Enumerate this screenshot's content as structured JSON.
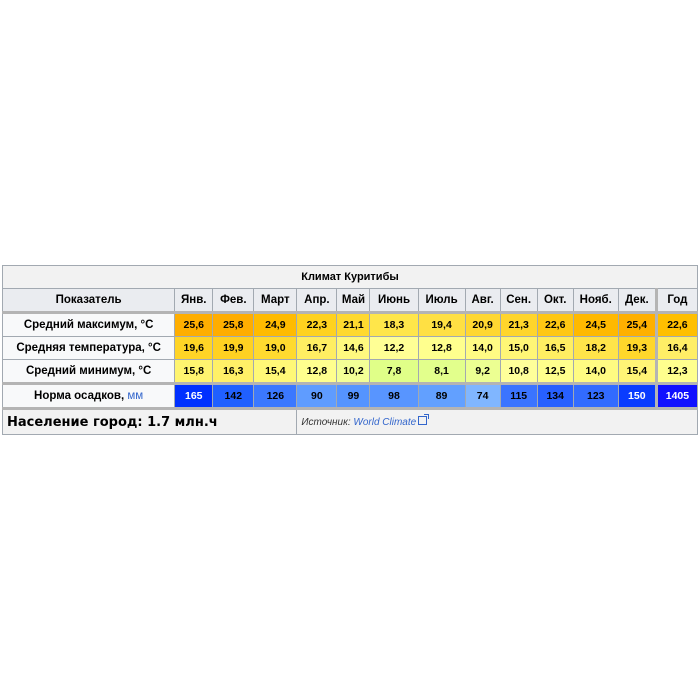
{
  "table": {
    "caption": "Климат Куритибы",
    "header_label": "Показатель",
    "months": [
      "Янв.",
      "Фев.",
      "Март",
      "Апр.",
      "Май",
      "Июнь",
      "Июль",
      "Авг.",
      "Сен.",
      "Окт.",
      "Нояб.",
      "Дек."
    ],
    "year_label": "Год",
    "rows": [
      {
        "label": "Средний максимум, °C",
        "values": [
          "25,6",
          "25,8",
          "24,9",
          "22,3",
          "21,1",
          "18,3",
          "19,4",
          "20,9",
          "21,3",
          "22,6",
          "24,5",
          "25,4"
        ],
        "year": "22,6",
        "colors": [
          "#ffae00",
          "#ffad00",
          "#ffbb00",
          "#ffd21f",
          "#ffd92f",
          "#ffe64a",
          "#ffe043",
          "#ffd731",
          "#ffd52b",
          "#ffc713",
          "#ffb900",
          "#ffb000"
        ],
        "year_color": "#ffbf00"
      },
      {
        "label": "Средняя температура, °C",
        "values": [
          "19,6",
          "19,9",
          "19,0",
          "16,7",
          "14,6",
          "12,2",
          "12,8",
          "14,0",
          "15,0",
          "16,5",
          "18,2",
          "19,3"
        ],
        "year": "16,4",
        "colors": [
          "#ffd426",
          "#ffd122",
          "#ffda2f",
          "#ffee62",
          "#fff97f",
          "#ffff95",
          "#ffff8e",
          "#fffb84",
          "#fff676",
          "#ffee62",
          "#ffe44a",
          "#ffd72b"
        ],
        "year_color": "#ffee66"
      },
      {
        "label": "Средний минимум, °C",
        "values": [
          "15,8",
          "16,3",
          "15,4",
          "12,8",
          "10,2",
          "7,8",
          "8,1",
          "9,2",
          "10,8",
          "12,5",
          "14,0",
          "15,4"
        ],
        "year": "12,3",
        "colors": [
          "#fff46f",
          "#fff067",
          "#fff877",
          "#ffff8e",
          "#f3ff96",
          "#e0ff88",
          "#e2ff8c",
          "#ecff92",
          "#ffff9a",
          "#ffff8c",
          "#fffb82",
          "#fff476"
        ],
        "year_color": "#ffff8e"
      }
    ],
    "precip": {
      "label": "Норма осадков,",
      "unit": "мм",
      "values": [
        "165",
        "142",
        "126",
        "90",
        "99",
        "98",
        "89",
        "74",
        "115",
        "134",
        "123",
        "150"
      ],
      "year": "1405",
      "colors": [
        "#0030ff",
        "#2060ff",
        "#3b78ff",
        "#5f9cff",
        "#5594ff",
        "#5895ff",
        "#62a0ff",
        "#80b6ff",
        "#3b74ff",
        "#2760ff",
        "#326bff",
        "#0a3cff"
      ],
      "year_color": "#1010ff"
    },
    "footer": {
      "population": "Население город: 1.7 млн.ч",
      "source_label": "Источник:",
      "source_link": "World Climate"
    }
  }
}
